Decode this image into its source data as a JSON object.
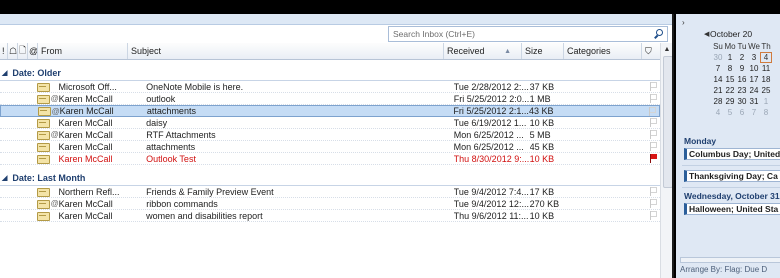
{
  "search": {
    "placeholder": "Search Inbox (Ctrl+E)"
  },
  "columns": {
    "from": "From",
    "subject": "Subject",
    "received": "Received",
    "size": "Size",
    "categories": "Categories"
  },
  "groups": [
    {
      "label": "Date: Older",
      "rows": [
        {
          "from": "Microsoft Off...",
          "subject": "OneNote Mobile is here.",
          "received": "Tue 2/28/2012 2:...",
          "size": "37 KB",
          "attach": false,
          "selected": false,
          "red": false,
          "flag": "empty"
        },
        {
          "from": "Karen McCall",
          "subject": "outlook",
          "received": "Fri 5/25/2012 2:0...",
          "size": "1 MB",
          "attach": true,
          "selected": false,
          "red": false,
          "flag": "empty"
        },
        {
          "from": "Karen McCall",
          "subject": "attachments",
          "received": "Fri 5/25/2012 2:1...",
          "size": "43 KB",
          "attach": true,
          "selected": true,
          "red": false,
          "flag": "empty"
        },
        {
          "from": "Karen McCall",
          "subject": "daisy",
          "received": "Tue 6/19/2012 1...",
          "size": "10 KB",
          "attach": false,
          "selected": false,
          "red": false,
          "flag": "empty"
        },
        {
          "from": "Karen McCall",
          "subject": "RTF Attachments",
          "received": "Mon 6/25/2012 ...",
          "size": "5 MB",
          "attach": true,
          "selected": false,
          "red": false,
          "flag": "empty"
        },
        {
          "from": "Karen McCall",
          "subject": "attachments",
          "received": "Mon 6/25/2012 ...",
          "size": "45 KB",
          "attach": false,
          "selected": false,
          "red": false,
          "flag": "empty"
        },
        {
          "from": "Karen McCall",
          "subject": "Outlook Test",
          "received": "Thu 8/30/2012 9:...",
          "size": "10 KB",
          "attach": false,
          "selected": false,
          "red": true,
          "flag": "red"
        }
      ]
    },
    {
      "label": "Date: Last Month",
      "rows": [
        {
          "from": "Northern Refl...",
          "subject": "Friends & Family Preview Event",
          "received": "Tue 9/4/2012 7:4...",
          "size": "17 KB",
          "attach": false,
          "selected": false,
          "red": false,
          "flag": "empty"
        },
        {
          "from": "Karen McCall",
          "subject": "ribbon commands",
          "received": "Tue 9/4/2012 12:...",
          "size": "270 KB",
          "attach": true,
          "selected": false,
          "red": false,
          "flag": "empty"
        },
        {
          "from": "Karen McCall",
          "subject": "women and disabilities report",
          "received": "Thu 9/6/2012 11:...",
          "size": "10 KB",
          "attach": false,
          "selected": false,
          "red": false,
          "flag": "empty"
        }
      ]
    }
  ],
  "calendar": {
    "month": "October 20",
    "dow": [
      "Su",
      "Mo",
      "Tu",
      "We",
      "Th"
    ],
    "weeks": [
      [
        "30",
        "1",
        "2",
        "3",
        "4"
      ],
      [
        "7",
        "8",
        "9",
        "10",
        "11"
      ],
      [
        "14",
        "15",
        "16",
        "17",
        "18"
      ],
      [
        "21",
        "22",
        "23",
        "24",
        "25"
      ],
      [
        "28",
        "29",
        "30",
        "31",
        "1"
      ],
      [
        "4",
        "5",
        "6",
        "7",
        "8"
      ]
    ]
  },
  "tasks": {
    "day1": "Monday",
    "event1": "Columbus Day; United",
    "event2": "Thanksgiving Day; Ca",
    "day2": "Wednesday, October 31",
    "event3": "Halloween; United Sta",
    "arrange": "Arrange By: Flag: Due D"
  }
}
